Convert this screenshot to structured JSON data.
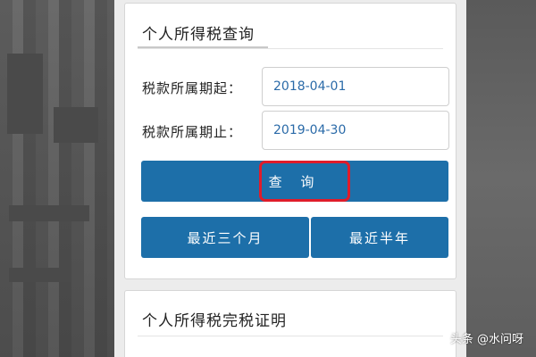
{
  "query_card": {
    "title": "个人所得税查询",
    "start_label": "税款所属期起：",
    "start_value": "2018-04-01",
    "end_label": "税款所属期止：",
    "end_value": "2019-04-30",
    "query_button": "查 询",
    "recent_three_months": "最近三个月",
    "recent_half_year": "最近半年"
  },
  "cert_card": {
    "title": "个人所得税完税证明"
  },
  "watermark": "头条 @水问呀",
  "colors": {
    "button_blue": "#1d6fa9",
    "highlight_red": "#e01c2a",
    "date_text": "#2a6aa8"
  }
}
